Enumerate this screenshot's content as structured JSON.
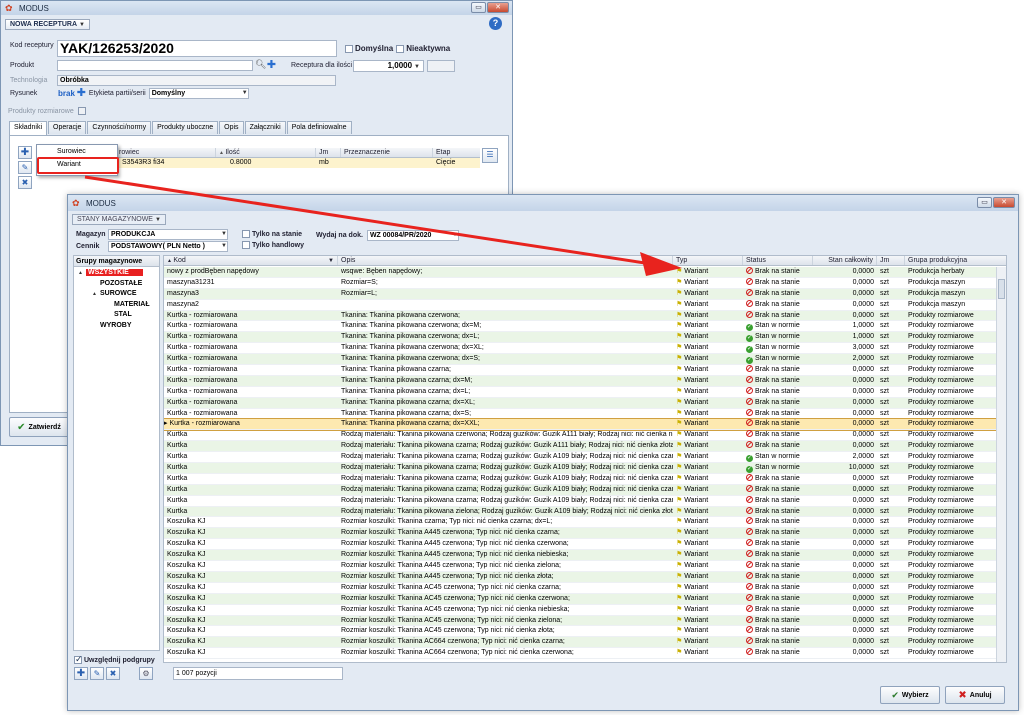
{
  "back_window": {
    "title": "MODUS",
    "mode": "NOWA RECEPTURA",
    "kod_label": "Kod receptury",
    "kod_value": "YAK/126253/2020",
    "domyslna": "Domyślna",
    "nieaktywna": "Nieaktywna",
    "produkt_label": "Produkt",
    "receptura_label": "Receptura dla ilości",
    "receptura_value": "1,0000",
    "technologia_label": "Technologia",
    "technologia_value": "Obróbka",
    "rysunek_label": "Rysunek",
    "rysunek_value": "brak",
    "etykieta_label": "Etykieta partii/serii",
    "etykieta_value": "Domyślny",
    "produkty_rozm_label": "Produkty rozmiarowe",
    "tabs": [
      "Składniki",
      "Operacje",
      "Czynności/normy",
      "Produkty uboczne",
      "Opis",
      "Załączniki",
      "Pola definiowalne"
    ],
    "grid_headers": [
      "rowiec",
      "Ilość",
      "Jm",
      "Przeznaczenie",
      "Etap"
    ],
    "grid_row": [
      "S3543R3 fi34",
      "0.8000",
      "mb",
      "",
      "Cięcie"
    ],
    "popup_items": [
      "Surowiec",
      "Wariant"
    ],
    "zatwierdz": "Zatwierdź"
  },
  "front_window": {
    "title": "MODUS",
    "mode": "STANY MAGAZYNOWE",
    "magazyn_label": "Magazyn",
    "magazyn_value": "PRODUKCJA",
    "cennik_label": "Cennik",
    "cennik_value": "PODSTAWOWY( PLN Netto )",
    "tylko_na_stanie": "Tylko na stanie",
    "tylko_handlowy": "Tylko handlowy",
    "wydaj_label": "Wydaj na dok.",
    "wydaj_value": "WZ 00084/PR/2020",
    "tree_header": "Grupy magazynowe",
    "tree": [
      {
        "label": "WSZYSTKIE",
        "level": 0,
        "exp": "▲",
        "selected": true
      },
      {
        "label": "POZOSTAŁE",
        "level": 1,
        "exp": "",
        "selected": false
      },
      {
        "label": "SUROWCE",
        "level": 1,
        "exp": "▲",
        "selected": false
      },
      {
        "label": "MATERIAŁ",
        "level": 2,
        "exp": "",
        "selected": false
      },
      {
        "label": "STAL",
        "level": 2,
        "exp": "",
        "selected": false
      },
      {
        "label": "WYROBY",
        "level": 1,
        "exp": "",
        "selected": false
      }
    ],
    "uwzglednij": "Uwzględnij podgrupy",
    "columns": [
      "Kod",
      "Opis",
      "Typ",
      "Status",
      "Stan całkowity",
      "Jm",
      "Grupa produkcyjna"
    ],
    "rows": [
      [
        "nowy z prodBęben napędowy",
        "wsqwe: Bęben napędowy;",
        "Wariant",
        "Brak na stanie",
        "0,0000",
        "szt",
        "Produkcja herbaty"
      ],
      [
        "maszyna31231",
        "Rozmiar=S;",
        "Wariant",
        "Brak na stanie",
        "0,0000",
        "szt",
        "Produkcja maszyn"
      ],
      [
        "maszyna3",
        "Rozmiar=L;",
        "Wariant",
        "Brak na stanie",
        "0,0000",
        "szt",
        "Produkcja maszyn"
      ],
      [
        "maszyna2",
        "",
        "Wariant",
        "Brak na stanie",
        "0,0000",
        "szt",
        "Produkcja maszyn"
      ],
      [
        "Kurtka - rozmiarowana",
        "Tkanina: Tkanina pikowana czerwona;",
        "Wariant",
        "Brak na stanie",
        "0,0000",
        "szt",
        "Produkty rozmiarowe"
      ],
      [
        "Kurtka - rozmiarowana",
        "Tkanina: Tkanina pikowana czerwona; dx=M;",
        "Wariant",
        "Stan w normie",
        "1,0000",
        "szt",
        "Produkty rozmiarowe"
      ],
      [
        "Kurtka - rozmiarowana",
        "Tkanina: Tkanina pikowana czerwona; dx=L;",
        "Wariant",
        "Stan w normie",
        "1,0000",
        "szt",
        "Produkty rozmiarowe"
      ],
      [
        "Kurtka - rozmiarowana",
        "Tkanina: Tkanina pikowana czerwona; dx=XL;",
        "Wariant",
        "Stan w normie",
        "3,0000",
        "szt",
        "Produkty rozmiarowe"
      ],
      [
        "Kurtka - rozmiarowana",
        "Tkanina: Tkanina pikowana czerwona; dx=S;",
        "Wariant",
        "Stan w normie",
        "2,0000",
        "szt",
        "Produkty rozmiarowe"
      ],
      [
        "Kurtka - rozmiarowana",
        "Tkanina: Tkanina pikowana czarna;",
        "Wariant",
        "Brak na stanie",
        "0,0000",
        "szt",
        "Produkty rozmiarowe"
      ],
      [
        "Kurtka - rozmiarowana",
        "Tkanina: Tkanina pikowana czarna; dx=M;",
        "Wariant",
        "Brak na stanie",
        "0,0000",
        "szt",
        "Produkty rozmiarowe"
      ],
      [
        "Kurtka - rozmiarowana",
        "Tkanina: Tkanina pikowana czarna; dx=L;",
        "Wariant",
        "Brak na stanie",
        "0,0000",
        "szt",
        "Produkty rozmiarowe"
      ],
      [
        "Kurtka - rozmiarowana",
        "Tkanina: Tkanina pikowana czarna; dx=XL;",
        "Wariant",
        "Brak na stanie",
        "0,0000",
        "szt",
        "Produkty rozmiarowe"
      ],
      [
        "Kurtka - rozmiarowana",
        "Tkanina: Tkanina pikowana czarna; dx=S;",
        "Wariant",
        "Brak na stanie",
        "0,0000",
        "szt",
        "Produkty rozmiarowe"
      ],
      [
        "Kurtka - rozmiarowana",
        "Tkanina: Tkanina pikowana czarna; dx=XXL;",
        "Wariant",
        "Brak na stanie",
        "0,0000",
        "szt",
        "Produkty rozmiarowe"
      ],
      [
        "Kurtka",
        "Rodzaj materiału: Tkanina pikowana czerwona; Rodzaj guzików: Guzik A111 biały; Rodzaj nici: nić cienka nie...",
        "Wariant",
        "Brak na stanie",
        "0,0000",
        "szt",
        "Produkty rozmiarowe"
      ],
      [
        "Kurtka",
        "Rodzaj materiału: Tkanina pikowana czarna; Rodzaj guzików: Guzik A111 biały; Rodzaj nici: nić cienka złota;...",
        "Wariant",
        "Brak na stanie",
        "0,0000",
        "szt",
        "Produkty rozmiarowe"
      ],
      [
        "Kurtka",
        "Rodzaj materiału: Tkanina pikowana czarna; Rodzaj guzików: Guzik A109 biały; Rodzaj nici: nić cienka czarn...",
        "Wariant",
        "Stan w normie",
        "2,0000",
        "szt",
        "Produkty rozmiarowe"
      ],
      [
        "Kurtka",
        "Rodzaj materiału: Tkanina pikowana czarna; Rodzaj guzików: Guzik A109 biały; Rodzaj nici: nić cienka czarn...",
        "Wariant",
        "Stan w normie",
        "10,0000",
        "szt",
        "Produkty rozmiarowe"
      ],
      [
        "Kurtka",
        "Rodzaj materiału: Tkanina pikowana czarna; Rodzaj guzików: Guzik A109 biały; Rodzaj nici: nić cienka czarn...",
        "Wariant",
        "Brak na stanie",
        "0,0000",
        "szt",
        "Produkty rozmiarowe"
      ],
      [
        "Kurtka",
        "Rodzaj materiału: Tkanina pikowana czarna; Rodzaj guzików: Guzik A109 biały; Rodzaj nici: nić cienka czarn...",
        "Wariant",
        "Brak na stanie",
        "0,0000",
        "szt",
        "Produkty rozmiarowe"
      ],
      [
        "Kurtka",
        "Rodzaj materiału: Tkanina pikowana czarna; Rodzaj guzików: Guzik A109 biały; Rodzaj nici: nić cienka czarn...",
        "Wariant",
        "Brak na stanie",
        "0,0000",
        "szt",
        "Produkty rozmiarowe"
      ],
      [
        "Kurtka",
        "Rodzaj materiału: Tkanina pikowana zielona; Rodzaj guzików: Guzik A109 biały; Rodzaj nici: nić cienka złota...",
        "Wariant",
        "Brak na stanie",
        "0,0000",
        "szt",
        "Produkty rozmiarowe"
      ],
      [
        "Koszulka KJ",
        "Rozmiar koszulki: Tkanina czarna; Typ nici: nić cienka czarna; dx=L;",
        "Wariant",
        "Brak na stanie",
        "0,0000",
        "szt",
        "Produkty rozmiarowe"
      ],
      [
        "Koszulka KJ",
        "Rozmiar koszulki: Tkanina A445 czerwona; Typ nici: nić cienka czarna;",
        "Wariant",
        "Brak na stanie",
        "0,0000",
        "szt",
        "Produkty rozmiarowe"
      ],
      [
        "Koszulka KJ",
        "Rozmiar koszulki: Tkanina A445 czerwona; Typ nici: nić cienka czerwona;",
        "Wariant",
        "Brak na stanie",
        "0,0000",
        "szt",
        "Produkty rozmiarowe"
      ],
      [
        "Koszulka KJ",
        "Rozmiar koszulki: Tkanina A445 czerwona; Typ nici: nić cienka niebieska;",
        "Wariant",
        "Brak na stanie",
        "0,0000",
        "szt",
        "Produkty rozmiarowe"
      ],
      [
        "Koszulka KJ",
        "Rozmiar koszulki: Tkanina A445 czerwona; Typ nici: nić cienka zielona;",
        "Wariant",
        "Brak na stanie",
        "0,0000",
        "szt",
        "Produkty rozmiarowe"
      ],
      [
        "Koszulka KJ",
        "Rozmiar koszulki: Tkanina A445 czerwona; Typ nici: nić cienka złota;",
        "Wariant",
        "Brak na stanie",
        "0,0000",
        "szt",
        "Produkty rozmiarowe"
      ],
      [
        "Koszulka KJ",
        "Rozmiar koszulki: Tkanina AC45 czerwona; Typ nici: nić cienka czarna;",
        "Wariant",
        "Brak na stanie",
        "0,0000",
        "szt",
        "Produkty rozmiarowe"
      ],
      [
        "Koszulka KJ",
        "Rozmiar koszulki: Tkanina AC45 czerwona; Typ nici: nić cienka czerwona;",
        "Wariant",
        "Brak na stanie",
        "0,0000",
        "szt",
        "Produkty rozmiarowe"
      ],
      [
        "Koszulka KJ",
        "Rozmiar koszulki: Tkanina AC45 czerwona; Typ nici: nić cienka niebieska;",
        "Wariant",
        "Brak na stanie",
        "0,0000",
        "szt",
        "Produkty rozmiarowe"
      ],
      [
        "Koszulka KJ",
        "Rozmiar koszulki: Tkanina AC45 czerwona; Typ nici: nić cienka zielona;",
        "Wariant",
        "Brak na stanie",
        "0,0000",
        "szt",
        "Produkty rozmiarowe"
      ],
      [
        "Koszulka KJ",
        "Rozmiar koszulki: Tkanina AC45 czerwona; Typ nici: nić cienka złota;",
        "Wariant",
        "Brak na stanie",
        "0,0000",
        "szt",
        "Produkty rozmiarowe"
      ],
      [
        "Koszulka KJ",
        "Rozmiar koszulki: Tkanina AC664 czerwona; Typ nici: nić cienka czarna;",
        "Wariant",
        "Brak na stanie",
        "0,0000",
        "szt",
        "Produkty rozmiarowe"
      ],
      [
        "Koszulka KJ",
        "Rozmiar koszulki: Tkanina AC664 czerwona; Typ nici: nić cienka czerwona;",
        "Wariant",
        "Brak na stanie",
        "0,0000",
        "szt",
        "Produkty rozmiarowe"
      ]
    ],
    "selected_row": 14,
    "count": "1 007 pozycji",
    "wybierz": "Wybierz",
    "anuluj": "Anuluj"
  },
  "colors": {
    "arrow": "#e8231e",
    "selected_tree": "#e82020",
    "row_green": "#eaf5e6",
    "row_selected": "#fde9b0"
  }
}
